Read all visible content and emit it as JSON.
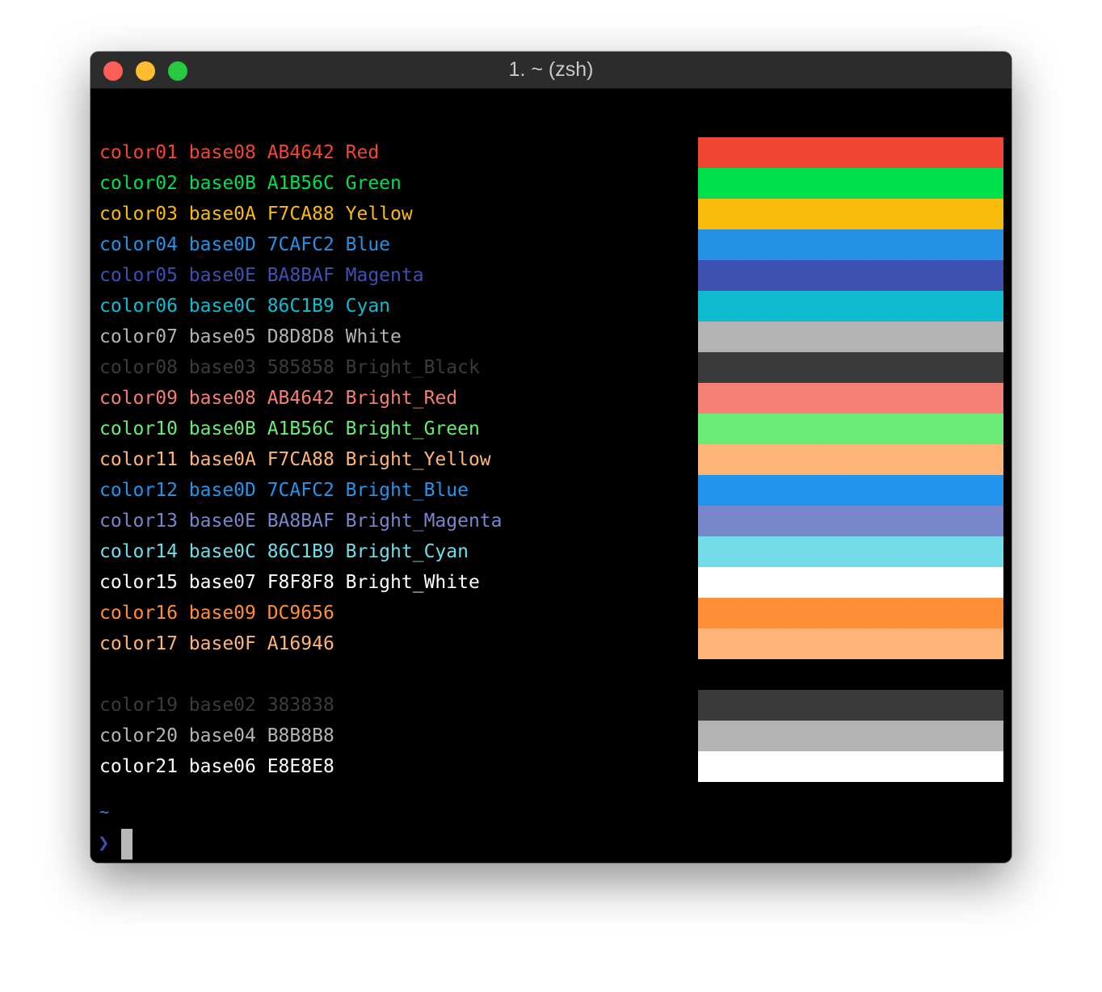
{
  "window": {
    "title": "1. ~ (zsh)"
  },
  "palette": [
    {
      "text": "color01 base08 AB4642 Red",
      "color": "#f24635",
      "swatch": "#f24635"
    },
    {
      "text": "color02 base0B A1B56C Green",
      "color": "#00e04d",
      "swatch": "#00e04d"
    },
    {
      "text": "color03 base0A F7CA88 Yellow",
      "color": "#f9bb0b",
      "swatch": "#f9bb0b"
    },
    {
      "text": "color04 base0D 7CAFC2 Blue",
      "color": "#2692e6",
      "swatch": "#2692e6"
    },
    {
      "text": "color05 base0E BA8BAF Magenta",
      "color": "#3f51b0",
      "swatch": "#3f51b0"
    },
    {
      "text": "color06 base0C 86C1B9 Cyan",
      "color": "#10bbd1",
      "swatch": "#10bbd1"
    },
    {
      "text": "color07 base05 D8D8D8 White",
      "color": "#b3b3b3",
      "swatch": "#b3b3b3"
    },
    {
      "text": "color08 base03 585858 Bright_Black",
      "color": "#3b3b3b",
      "swatch": "#3b3b3b"
    },
    {
      "text": "color09 base08 AB4642 Bright_Red",
      "color": "#f47f74",
      "swatch": "#f47f74"
    },
    {
      "text": "color10 base0B A1B56C Bright_Green",
      "color": "#68ec75",
      "swatch": "#68ec75"
    },
    {
      "text": "color11 base0A F7CA88 Bright_Yellow",
      "color": "#ffb478",
      "swatch": "#ffb478"
    },
    {
      "text": "color12 base0D 7CAFC2 Bright_Blue",
      "color": "#2495ec",
      "swatch": "#2495ec"
    },
    {
      "text": "color13 base0E BA8BAF Bright_Magenta",
      "color": "#7986c9",
      "swatch": "#7986c9"
    },
    {
      "text": "color14 base0C 86C1B9 Bright_Cyan",
      "color": "#72dde8",
      "swatch": "#72dde8"
    },
    {
      "text": "color15 base07 F8F8F8 Bright_White",
      "color": "#ffffff",
      "swatch": "#ffffff"
    },
    {
      "text": "color16 base09 DC9656",
      "color": "#ff8e38",
      "swatch": "#ff8e38"
    },
    {
      "text": "color17 base0F A16946",
      "color": "#ffb478",
      "swatch": "#ffb478"
    }
  ],
  "extra": [
    {
      "text": "color19 base02 383838",
      "color": "#3b3b3b",
      "swatch": "#3b3b3b"
    },
    {
      "text": "color20 base04 B8B8B8",
      "color": "#b3b3b3",
      "swatch": "#b3b3b3"
    },
    {
      "text": "color21 base06 E8E8E8",
      "color": "#ffffff",
      "swatch": "#ffffff"
    }
  ],
  "prompt": {
    "dir": "~",
    "symbol": "❯"
  }
}
